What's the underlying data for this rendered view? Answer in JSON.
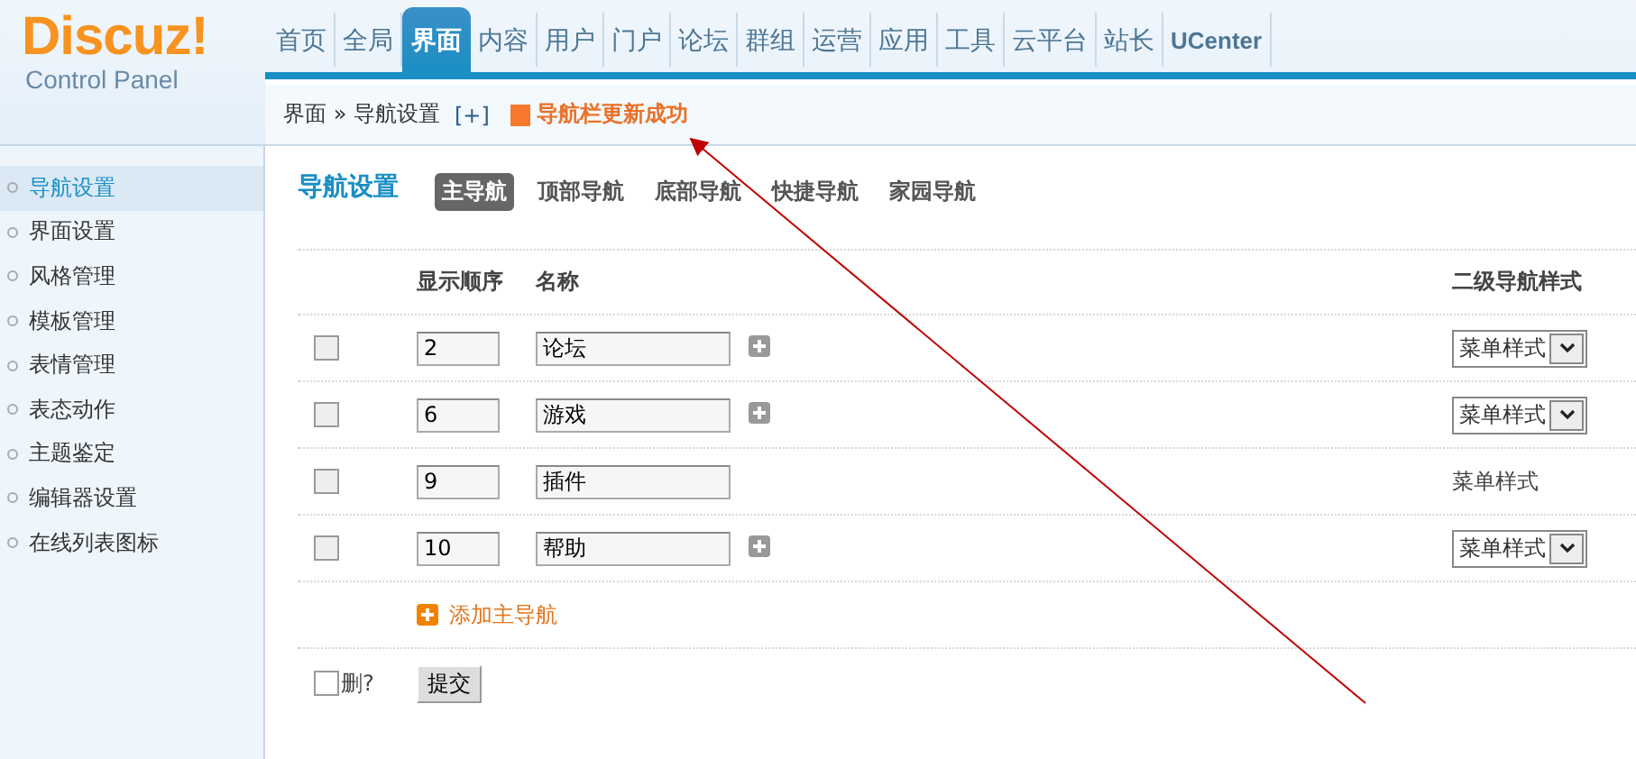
{
  "logo": {
    "title": "Discuz!",
    "subtitle": "Control Panel"
  },
  "top_nav": [
    {
      "label": "首页",
      "selected": false
    },
    {
      "label": "全局",
      "selected": false
    },
    {
      "label": "界面",
      "selected": true
    },
    {
      "label": "内容",
      "selected": false
    },
    {
      "label": "用户",
      "selected": false
    },
    {
      "label": "门户",
      "selected": false
    },
    {
      "label": "论坛",
      "selected": false
    },
    {
      "label": "群组",
      "selected": false
    },
    {
      "label": "运营",
      "selected": false
    },
    {
      "label": "应用",
      "selected": false
    },
    {
      "label": "工具",
      "selected": false
    },
    {
      "label": "云平台",
      "selected": false
    },
    {
      "label": "站长",
      "selected": false
    },
    {
      "label": "UCenter",
      "selected": false
    }
  ],
  "breadcrumb": {
    "path": "界面 » 导航设置",
    "add": "[+]",
    "message": "导航栏更新成功"
  },
  "sidebar": {
    "items": [
      {
        "label": "导航设置",
        "selected": true
      },
      {
        "label": "界面设置",
        "selected": false
      },
      {
        "label": "风格管理",
        "selected": false
      },
      {
        "label": "模板管理",
        "selected": false
      },
      {
        "label": "表情管理",
        "selected": false
      },
      {
        "label": "表态动作",
        "selected": false
      },
      {
        "label": "主题鉴定",
        "selected": false
      },
      {
        "label": "编辑器设置",
        "selected": false
      },
      {
        "label": "在线列表图标",
        "selected": false
      }
    ]
  },
  "page_title": "导航设置",
  "tabs": [
    {
      "label": "主导航",
      "selected": true
    },
    {
      "label": "顶部导航",
      "selected": false
    },
    {
      "label": "底部导航",
      "selected": false
    },
    {
      "label": "快捷导航",
      "selected": false
    },
    {
      "label": "家园导航",
      "selected": false
    }
  ],
  "table": {
    "columns": [
      "显示顺序",
      "名称",
      "二级导航样式"
    ],
    "rows": [
      {
        "checked": false,
        "order": "2",
        "name": "论坛",
        "addable": true,
        "kind": "select",
        "style": "菜单样式"
      },
      {
        "checked": false,
        "order": "6",
        "name": "游戏",
        "addable": true,
        "kind": "select",
        "style": "菜单样式"
      },
      {
        "checked": false,
        "order": "9",
        "name": "插件",
        "addable": false,
        "kind": "text",
        "style": "菜单样式"
      },
      {
        "checked": false,
        "order": "10",
        "name": "帮助",
        "addable": true,
        "kind": "select",
        "style": "菜单样式"
      }
    ]
  },
  "add_link": "添加主导航",
  "footer": {
    "delete_label": "删?",
    "delete_checked": false,
    "submit": "提交"
  }
}
